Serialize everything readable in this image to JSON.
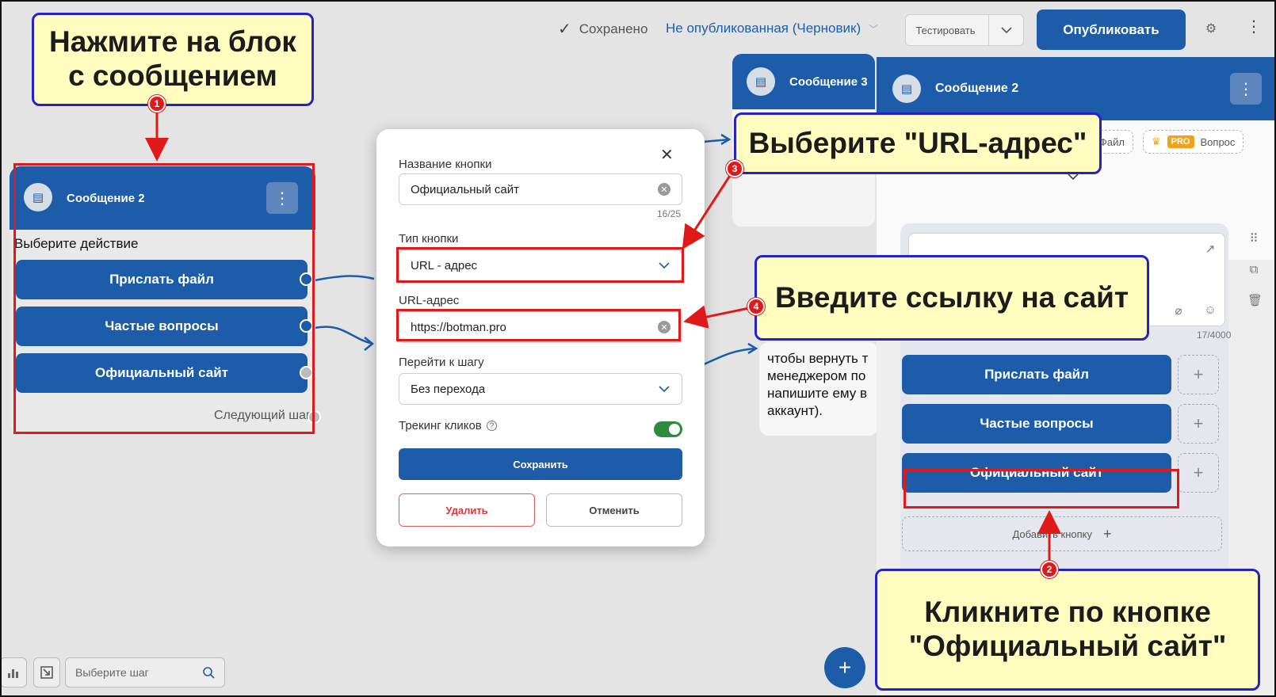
{
  "topbar": {
    "saved_label": "Сохранено",
    "status_label": "Не опубликованная (Черновик)",
    "test_label": "Тестировать",
    "publish_label": "Опубликовать"
  },
  "left_node": {
    "title": "Сообщение 2",
    "prompt": "Выберите действие",
    "buttons": [
      "Прислать файл",
      "Частые вопросы",
      "Официальный сайт"
    ],
    "next_step": "Следующий шаг"
  },
  "node3": {
    "title": "Сообщение 3"
  },
  "partial_text": "чтобы вернуть т\nменеджером по\nнапишите ему в\nаккаунт).",
  "modal": {
    "button_name_label": "Название кнопки",
    "button_name_value": "Официальный сайт",
    "button_name_counter": "16/25",
    "type_label": "Тип кнопки",
    "type_value": "URL - адрес",
    "url_label": "URL-адрес",
    "url_value": "https://botman.pro",
    "goto_label": "Перейти к шагу",
    "goto_value": "Без перехода",
    "tracking_label": "Трекинг кликов",
    "tracking_on": true,
    "save_label": "Сохранить",
    "delete_label": "Удалить",
    "cancel_label": "Отменить"
  },
  "panel": {
    "title": "Сообщение 2",
    "tab_file": "Файл",
    "pro_badge": "PRO",
    "tab_question": "Вопрос",
    "text_counter": "17/4000",
    "buttons": [
      "Прислать файл",
      "Частые вопросы",
      "Официальный сайт"
    ],
    "add_button_label": "Добавить кнопку"
  },
  "bottom": {
    "search_placeholder": "Выберите шаг"
  },
  "callouts": {
    "c1": "Нажмите на блок\nс сообщением",
    "c2": "Кликните по кнопке\n\"Официальный сайт\"",
    "c3": "Выберите \"URL-адрес\"",
    "c4": "Введите ссылку на сайт"
  },
  "badges": [
    "1",
    "2",
    "3",
    "4"
  ],
  "colors": {
    "brand_blue": "#1c5ca8",
    "highlight_red": "#e01a1a",
    "callout_bg": "#fffdc0",
    "callout_border": "#2323c8",
    "toggle_green": "#2e8b3c"
  }
}
